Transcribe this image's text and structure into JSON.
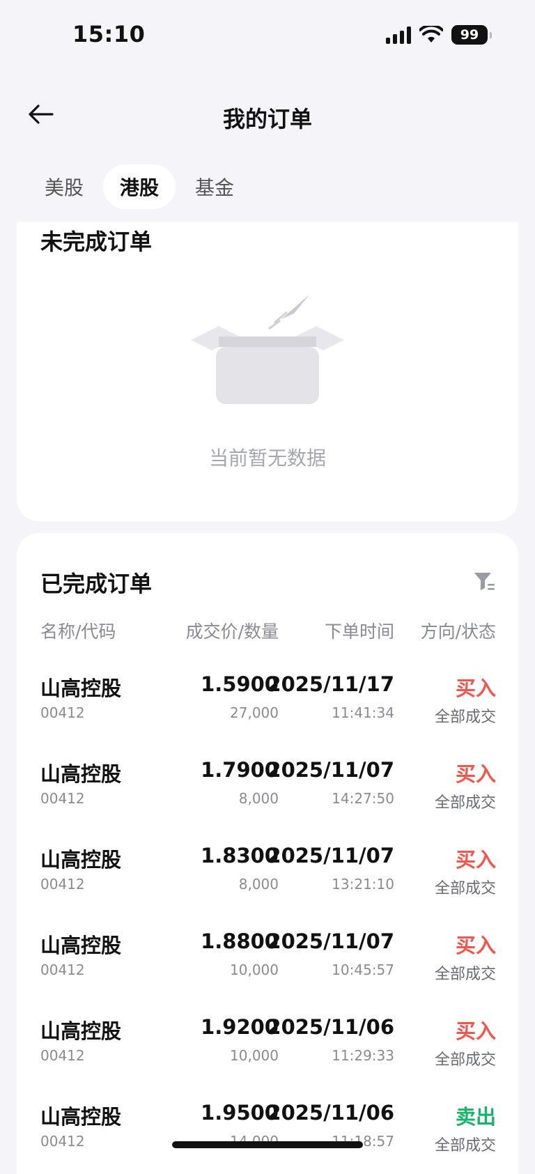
{
  "status_bar": {
    "time": "15:10",
    "battery": "99"
  },
  "header": {
    "title": "我的订单"
  },
  "tabs": [
    {
      "label": "美股",
      "active": false
    },
    {
      "label": "港股",
      "active": true
    },
    {
      "label": "基金",
      "active": false
    }
  ],
  "pending": {
    "title": "未完成订单",
    "empty_text": "当前暂无数据"
  },
  "completed": {
    "title": "已完成订单",
    "columns": [
      "名称/代码",
      "成交价/数量",
      "下单时间",
      "方向/状态"
    ],
    "rows": [
      {
        "name": "山高控股",
        "code": "00412",
        "price": "1.5900",
        "qty": "27,000",
        "date": "2025/11/17",
        "time": "11:41:34",
        "direction": "买入",
        "status": "全部成交"
      },
      {
        "name": "山高控股",
        "code": "00412",
        "price": "1.7900",
        "qty": "8,000",
        "date": "2025/11/07",
        "time": "14:27:50",
        "direction": "买入",
        "status": "全部成交"
      },
      {
        "name": "山高控股",
        "code": "00412",
        "price": "1.8300",
        "qty": "8,000",
        "date": "2025/11/07",
        "time": "13:21:10",
        "direction": "买入",
        "status": "全部成交"
      },
      {
        "name": "山高控股",
        "code": "00412",
        "price": "1.8800",
        "qty": "10,000",
        "date": "2025/11/07",
        "time": "10:45:57",
        "direction": "买入",
        "status": "全部成交"
      },
      {
        "name": "山高控股",
        "code": "00412",
        "price": "1.9200",
        "qty": "10,000",
        "date": "2025/11/06",
        "time": "11:29:33",
        "direction": "买入",
        "status": "全部成交"
      },
      {
        "name": "山高控股",
        "code": "00412",
        "price": "1.9500",
        "qty": "14,000",
        "date": "2025/11/06",
        "time": "11:18:57",
        "direction": "卖出",
        "status": "全部成交"
      }
    ]
  },
  "colors": {
    "buy": "#F2564D",
    "sell": "#19B36B",
    "page_bg": "#F4F4F9"
  },
  "icons": {
    "back": "arrow-left-icon",
    "filter": "filter-icon",
    "empty": "empty-box-icon"
  }
}
